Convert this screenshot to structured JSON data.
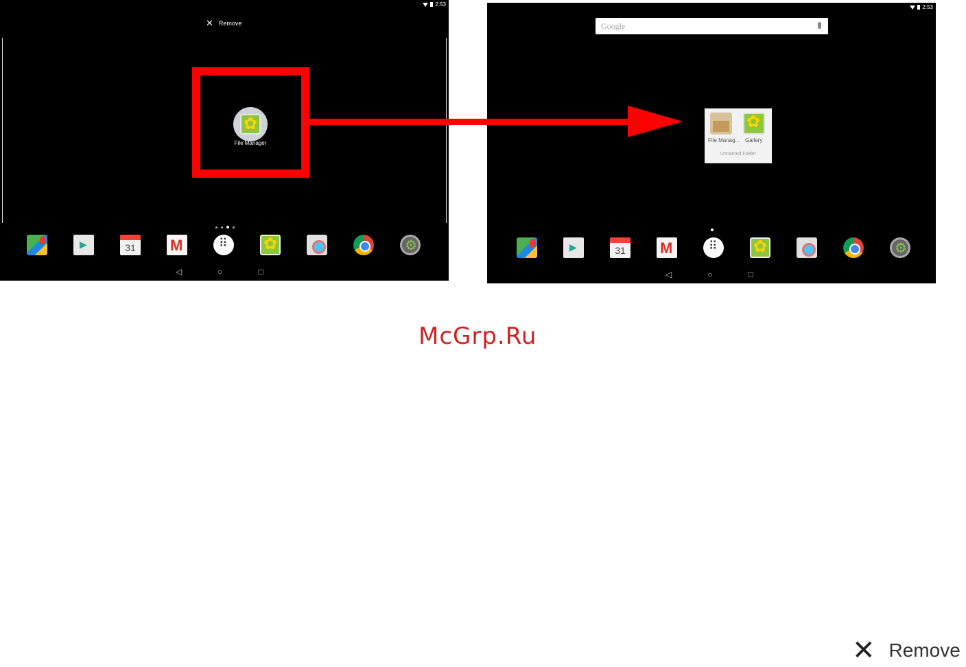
{
  "left_screen": {
    "time": "2:53",
    "remove_label": "Remove",
    "dragged_app_label": "File Manager",
    "calendar_date": "31"
  },
  "right_screen": {
    "time": "2:53",
    "search_placeholder": "Google",
    "folder": {
      "item_1": "File Manag...",
      "item_2": "Gallery",
      "name": "Unnamed Folder"
    },
    "calendar_date": "31"
  },
  "dock_icons": [
    "maps-icon",
    "play-store-icon",
    "calendar-icon",
    "gmail-icon",
    "app-launcher-icon",
    "gallery-icon",
    "camera-icon",
    "chrome-icon",
    "settings-icon"
  ],
  "navbar": {
    "back": "◁",
    "home": "○",
    "recents": "□"
  },
  "watermark": "McGrp.Ru",
  "callout": {
    "remove_label": "Remove"
  },
  "colors": {
    "annotation_red": "#ff0000",
    "watermark_red": "#cc2222",
    "screen_bg": "#000000"
  }
}
